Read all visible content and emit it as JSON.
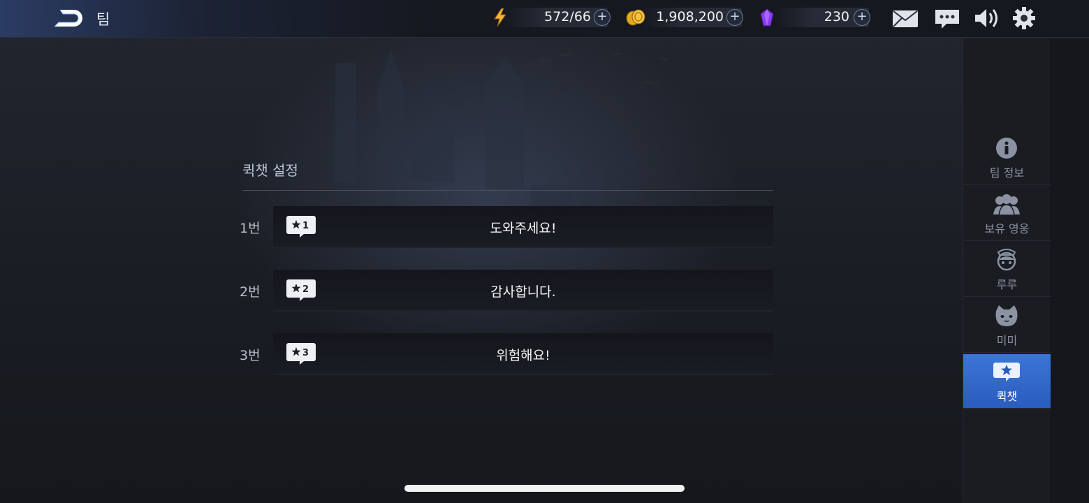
{
  "header": {
    "title": "팀",
    "logo_icon": "back-d-logo-icon",
    "stamina": "572/66",
    "gold": "1,908,200",
    "gems": "230",
    "icons": [
      "mail-icon",
      "chat-bubble-icon",
      "speaker-icon",
      "gear-icon"
    ]
  },
  "quickchat": {
    "title": "퀵챗 설정",
    "rows": [
      {
        "label": "1번",
        "badge": "1",
        "text": "도와주세요!"
      },
      {
        "label": "2번",
        "badge": "2",
        "text": "감사합니다."
      },
      {
        "label": "3번",
        "badge": "3",
        "text": "위험해요!"
      }
    ]
  },
  "sidebar": {
    "items": [
      {
        "label": "팀 정보",
        "icon": "info-icon"
      },
      {
        "label": "보유 영웅",
        "icon": "heroes-icon"
      },
      {
        "label": "루루",
        "icon": "girl-face-icon"
      },
      {
        "label": "미미",
        "icon": "cat-face-icon"
      },
      {
        "label": "퀵챗",
        "icon": "quickchat-star-icon",
        "active": true
      }
    ]
  },
  "colors": {
    "accent": "#3c76d8",
    "background": "#1b1e25"
  }
}
